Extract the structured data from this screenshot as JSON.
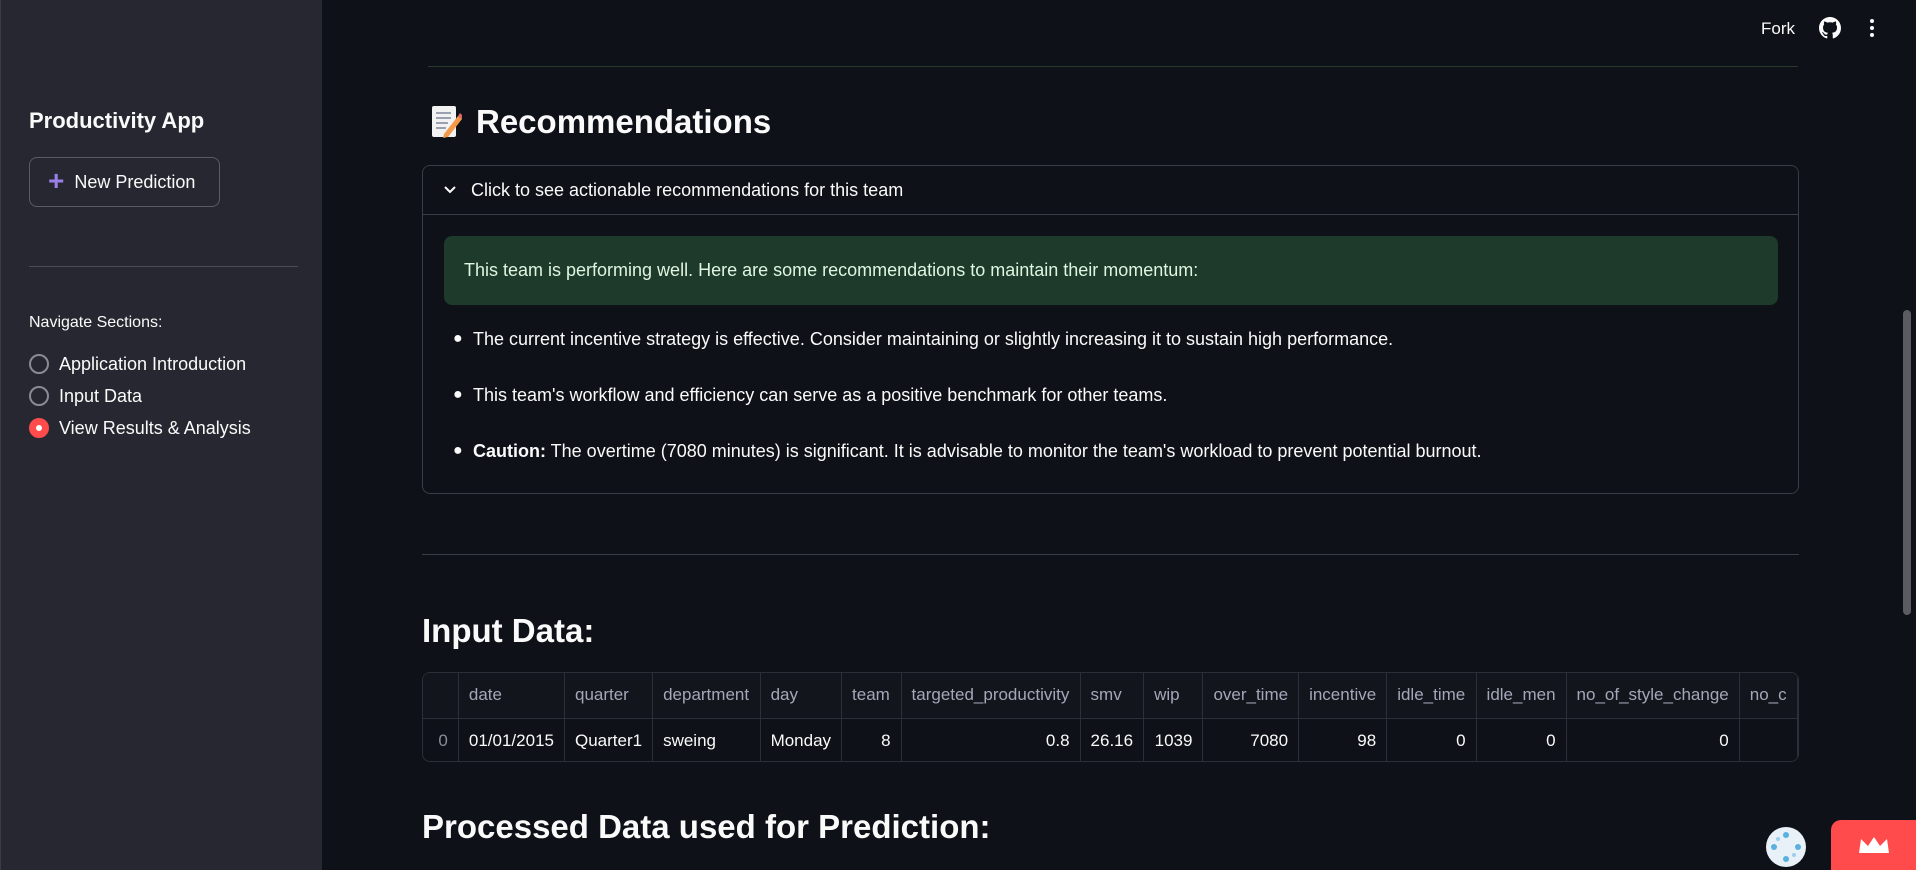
{
  "sidebar": {
    "title": "Productivity App",
    "new_prediction_label": "New Prediction",
    "nav_label": "Navigate Sections:",
    "nav_options": [
      {
        "label": "Application Introduction",
        "selected": false
      },
      {
        "label": "Input Data",
        "selected": false
      },
      {
        "label": "View Results & Analysis",
        "selected": true
      }
    ]
  },
  "toolbar": {
    "fork_label": "Fork"
  },
  "recommendations": {
    "heading": "Recommendations",
    "expander_label": "Click to see actionable recommendations for this team",
    "success_message": "This team is performing well. Here are some recommendations to maintain their momentum:",
    "items": [
      {
        "bold": "",
        "text": "The current incentive strategy is effective. Consider maintaining or slightly increasing it to sustain high performance."
      },
      {
        "bold": "",
        "text": "This team's workflow and efficiency can serve as a positive benchmark for other teams."
      },
      {
        "bold": "Caution:",
        "text": " The overtime (7080 minutes) is significant. It is advisable to monitor the team's workload to prevent potential burnout."
      }
    ]
  },
  "input_data": {
    "heading": "Input Data:",
    "columns": [
      "",
      "date",
      "quarter",
      "department",
      "day",
      "team",
      "targeted_productivity",
      "smv",
      "wip",
      "over_time",
      "incentive",
      "idle_time",
      "idle_men",
      "no_of_style_change",
      "no_c"
    ],
    "rows": [
      [
        "0",
        "01/01/2015",
        "Quarter1",
        "sweing",
        "Monday",
        "8",
        "0.8",
        "26.16",
        "1039",
        "7080",
        "98",
        "0",
        "0",
        "0",
        ""
      ]
    ]
  },
  "processed_data": {
    "heading": "Processed Data used for Prediction:"
  },
  "colors": {
    "accent": "#ff4b4b",
    "success_bg": "#1d3a2a",
    "sidebar_bg": "#262730",
    "main_bg": "#0e1117"
  }
}
